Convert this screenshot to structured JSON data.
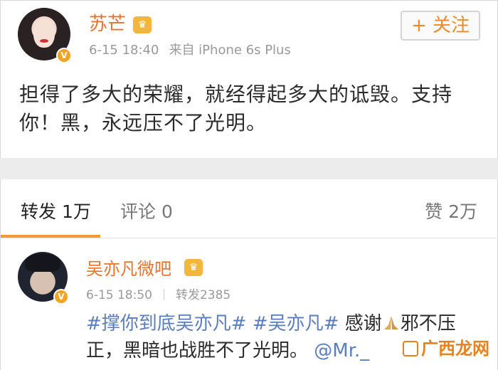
{
  "post": {
    "author": "苏芒",
    "date": "6-15 18:40",
    "source": "来自 iPhone 6s Plus",
    "follow_label": "+ 关注",
    "text": "担得了多大的荣耀，就经得起多大的诋毁。支持你！黑，永远压不了光明。"
  },
  "tabs": {
    "repost": "转发 1万",
    "comment": "评论 0",
    "like": "赞 2万"
  },
  "repost": {
    "author": "吴亦凡微吧",
    "date": "6-15 18:50",
    "repost_count": "转发2385",
    "tag1": "#撑你到底吴亦凡#",
    "tag2": "#吴亦凡#",
    "text_a": "感谢",
    "text_b": "邪不压正，黑暗也战胜不了光明。",
    "mention": "@Mr._"
  },
  "watermark": "广西龙网",
  "colors": {
    "accent_orange": "#e9722c",
    "link_blue": "#5a7dbe",
    "tab_underline": "#f29a38"
  }
}
